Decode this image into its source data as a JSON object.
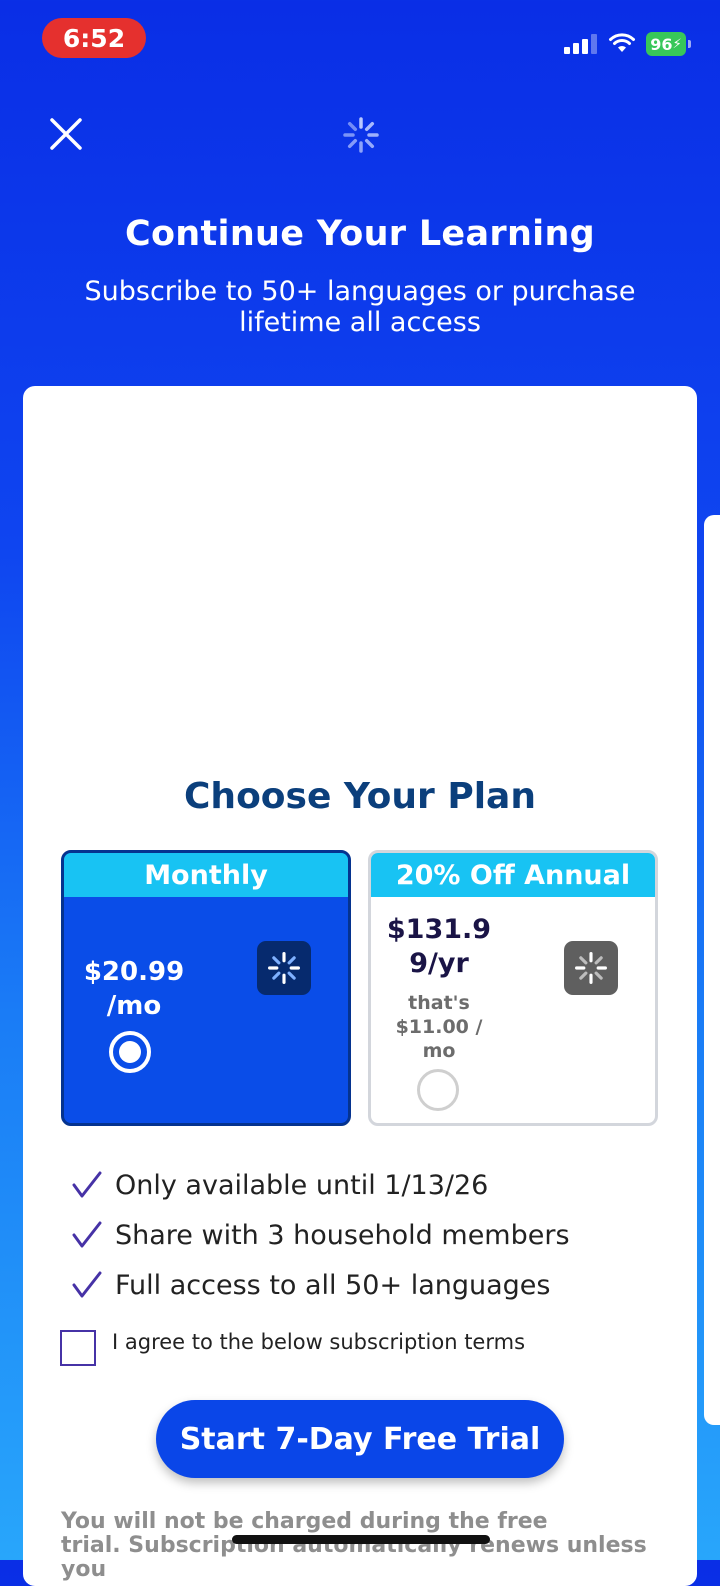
{
  "status_bar": {
    "time": "6:52",
    "battery": "96",
    "icons": [
      "signal-icon",
      "wifi-icon",
      "battery-charging-icon"
    ],
    "time_pill_color": "#e5302e",
    "battery_color": "#38c759"
  },
  "header": {
    "close_icon": "close-icon",
    "logo_icon": "spinner-logo-icon",
    "title": "Continue Your Learning",
    "subtitle": "Subscribe to 50+ languages or purchase lifetime all access"
  },
  "plans": {
    "title": "Choose Your Plan",
    "options": [
      {
        "name": "Monthly",
        "price_line1": "$20.99",
        "price_line2": "/mo",
        "selected": true,
        "badge_icon": "spinner-icon"
      },
      {
        "name": "20% Off Annual",
        "price_line1": "$131.9",
        "price_line2": "9/yr",
        "per_month_1": "that's",
        "per_month_2": "$11.00 /",
        "per_month_3": "mo",
        "selected": false,
        "badge_icon": "spinner-icon"
      }
    ]
  },
  "features": [
    "Only available until 1/13/26",
    "Share with 3 household members",
    "Full access to all 50+ languages"
  ],
  "agreement": {
    "label": "I agree to the below subscription terms",
    "checked": false
  },
  "cta": {
    "label": "Start 7-Day Free Trial"
  },
  "disclaimer": {
    "line1": "You will not be charged during the free",
    "line2": "trial. Subscription automatically renews unless you"
  },
  "colors": {
    "brand_blue": "#0a46e8",
    "plan_header_cyan": "#18c3f3",
    "title_navy": "#0b3f7c",
    "check_purple": "#4632a6"
  }
}
